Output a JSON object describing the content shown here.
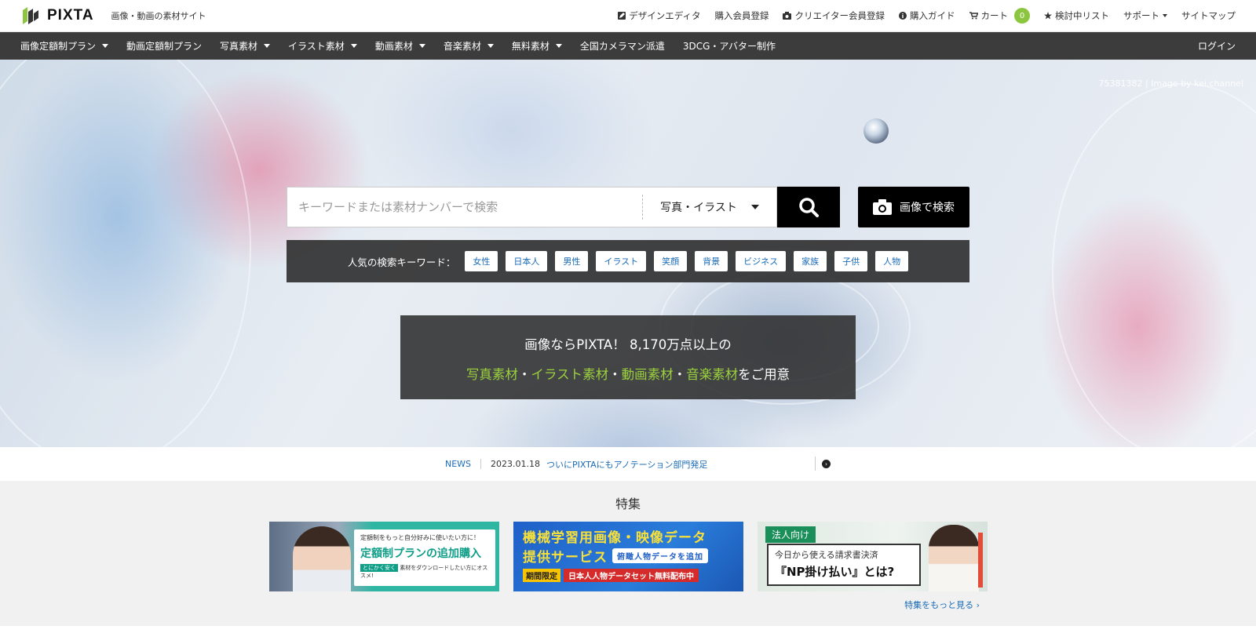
{
  "header": {
    "logo_text": "PIXTA",
    "tagline": "画像・動画の素材サイト",
    "links": [
      {
        "label": "デザインエディタ",
        "icon": "edit-icon"
      },
      {
        "label": "購入会員登録",
        "icon": ""
      },
      {
        "label": "クリエイター会員登録",
        "icon": "camera-icon"
      },
      {
        "label": "購入ガイド",
        "icon": "info-icon"
      },
      {
        "label": "カート",
        "icon": "cart-icon"
      },
      {
        "label": "検討中リスト",
        "icon": "star-icon"
      },
      {
        "label": "サポート",
        "icon": ""
      },
      {
        "label": "サイトマップ",
        "icon": ""
      }
    ],
    "cart_count": "0"
  },
  "nav": {
    "items": [
      {
        "label": "画像定額制プラン",
        "dropdown": true
      },
      {
        "label": "動画定額制プラン",
        "dropdown": false
      },
      {
        "label": "写真素材",
        "dropdown": true
      },
      {
        "label": "イラスト素材",
        "dropdown": true
      },
      {
        "label": "動画素材",
        "dropdown": true
      },
      {
        "label": "音楽素材",
        "dropdown": true
      },
      {
        "label": "無料素材",
        "dropdown": true
      },
      {
        "label": "全国カメラマン派遣",
        "dropdown": false
      },
      {
        "label": "3DCG・アバター制作",
        "dropdown": false
      }
    ],
    "login": "ログイン"
  },
  "hero": {
    "credit": "75381382 | Image by kei.channel",
    "search_placeholder": "キーワードまたは素材ナンバーで検索",
    "category": "写真・イラスト",
    "image_search_label": "画像で検索",
    "keywords_label": "人気の検索キーワード：",
    "keywords": [
      "女性",
      "日本人",
      "男性",
      "イラスト",
      "笑顔",
      "背景",
      "ビジネス",
      "家族",
      "子供",
      "人物"
    ],
    "promo_line1": "画像ならPIXTA！ 8,170万点以上の",
    "promo_line2_parts": [
      "写真素材",
      "・",
      "イラスト素材",
      "・",
      "動画素材",
      "・",
      "音楽素材",
      "をご用意"
    ]
  },
  "news": {
    "label": "NEWS",
    "date": "2023.01.18",
    "text": "ついにPIXTAにもアノテーション部門発足"
  },
  "features": {
    "title": "特集",
    "more": "特集をもっと見る",
    "banner1": {
      "line1": "定額制をもっと自分好みに使いたい方に！",
      "line2": "定額制プランの追加購入",
      "tag": "とにかく安く",
      "line3": "素材をダウンロードしたい方にオススメ!"
    },
    "banner2": {
      "line1": "機械学習用画像・映像データ",
      "line2": "提供サービス",
      "pill": "俯瞰人物データを追加",
      "tag1": "期間限定",
      "tag2": "日本人人物データセット無料配布中"
    },
    "banner3": {
      "tag": "法人向け",
      "line1": "今日から使える請求書決済",
      "line2": "『NP掛け払い』とは?"
    }
  },
  "colors": {
    "accent_green": "#8cc63f",
    "nav_bg": "#3c3c3c",
    "link_blue": "#1a6bb8"
  }
}
